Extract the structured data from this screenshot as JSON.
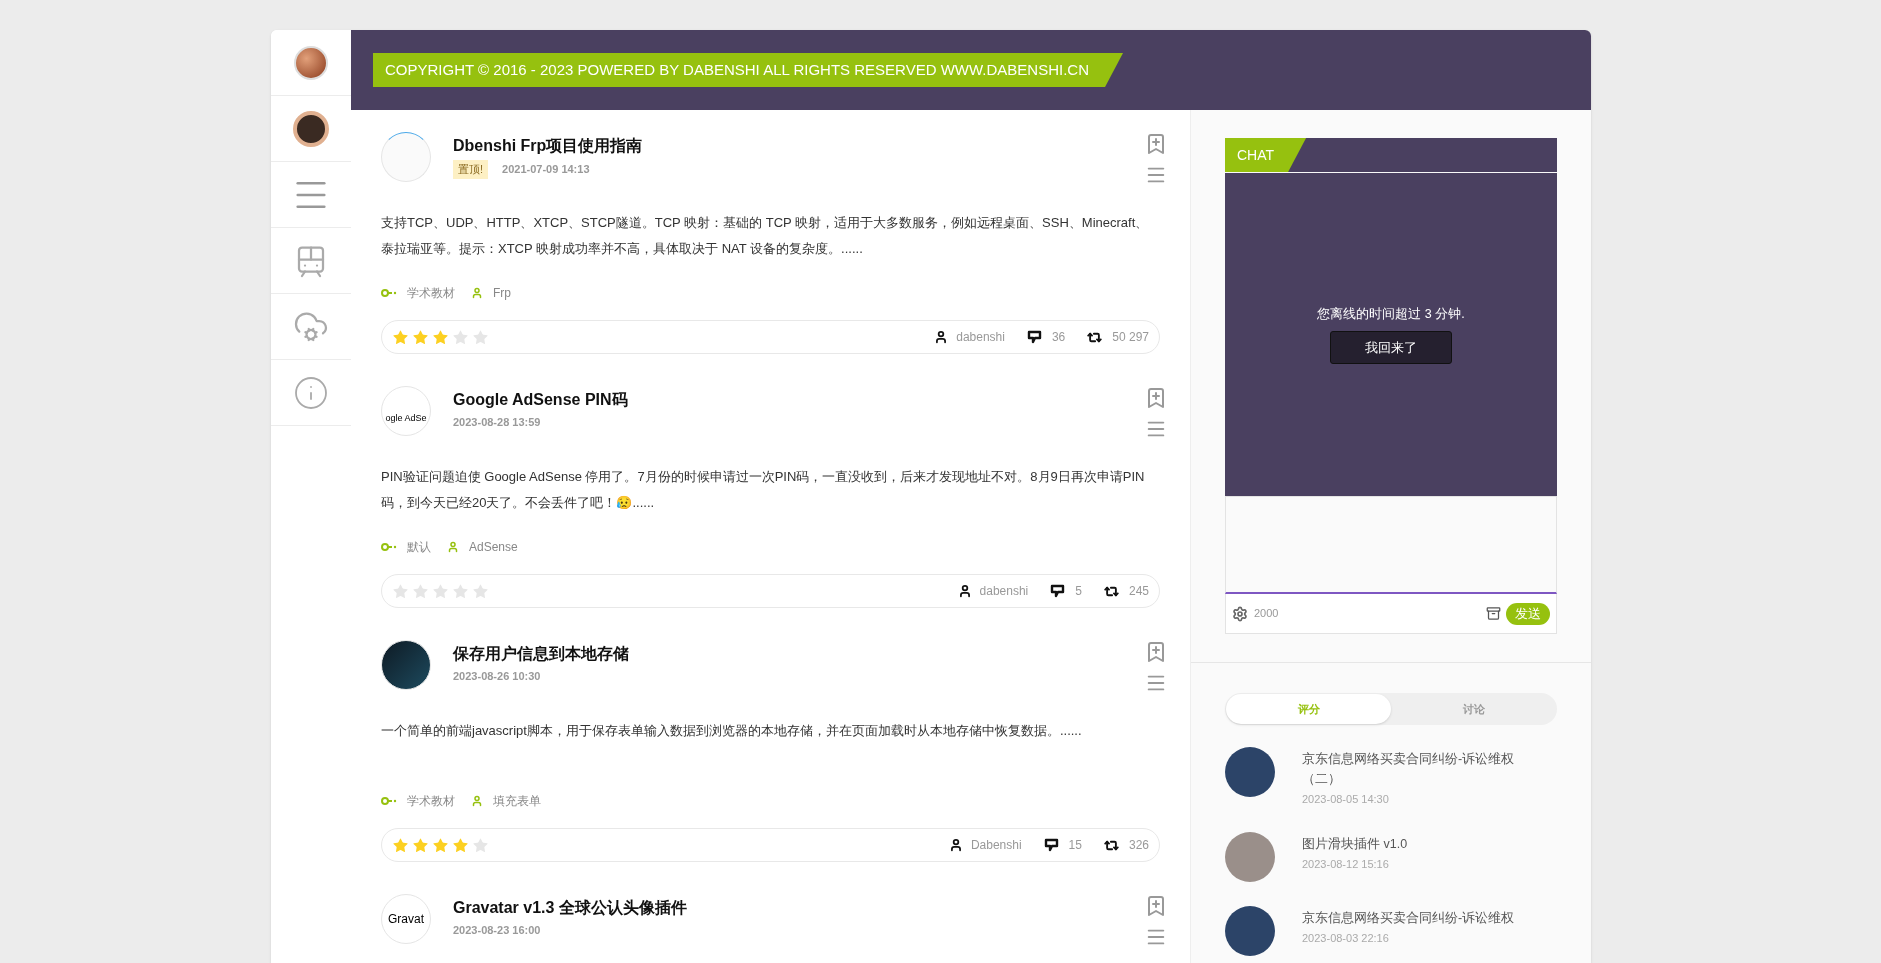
{
  "header": {
    "copyright": "COPYRIGHT © 2016 - 2023 POWERED BY DABENSHI ALL RIGHTS RESERVED WWW.DABENSHI.CN"
  },
  "sidebar": {
    "items": [
      {
        "kind": "logo"
      },
      {
        "kind": "avatar"
      },
      {
        "kind": "menu"
      },
      {
        "kind": "train"
      },
      {
        "kind": "cloud"
      },
      {
        "kind": "info"
      }
    ]
  },
  "posts": [
    {
      "title": "Dbenshi Frp项目使用指南",
      "badge": "置顶!",
      "date": "2021-07-09 14:13",
      "kind": "dots",
      "excerpt": "支持TCP、UDP、HTTP、XTCP、STCP隧道。TCP 映射：基础的 TCP 映射，适用于大多数服务，例如远程桌面、SSH、Minecraft、泰拉瑞亚等。提示：XTCP 映射成功率并不高，具体取决于 NAT 设备的复杂度。......",
      "category": "学术教材",
      "tag": "Frp",
      "stars": 3,
      "author": "dabenshi",
      "comments": "36",
      "views": "50 297"
    },
    {
      "title": "Google AdSense PIN码",
      "date": "2023-08-28 13:59",
      "kind": "adsense",
      "thumb_text": "ogle AdSe",
      "excerpt": "PIN验证问题迫使 Google AdSense 停用了。7月份的时候申请过一次PIN码，一直没收到，后来才发现地址不对。8月9日再次申请PIN码，到今天已经20天了。不会丢件了吧！😥......",
      "category": "默认",
      "tag": "AdSense",
      "stars": 0,
      "author": "dabenshi",
      "comments": "5",
      "views": "245"
    },
    {
      "title": "保存用户信息到本地存储",
      "date": "2023-08-26 10:30",
      "kind": "code",
      "excerpt": "一个简单的前端javascript脚本，用于保存表单输入数据到浏览器的本地存储，并在页面加载时从本地存储中恢复数据。......",
      "category": "学术教材",
      "tag": "填充表单",
      "stars": 4,
      "author": "Dabenshi",
      "comments": "15",
      "views": "326"
    },
    {
      "title": "Gravatar v1.3 全球公认头像插件",
      "date": "2023-08-23 16:00",
      "kind": "gravatar",
      "thumb_text": "Gravat"
    }
  ],
  "chat": {
    "title": "CHAT",
    "message": "您离线的时间超过 3 分钟.",
    "return_button": "我回来了",
    "counter": "2000",
    "send_button": "发送"
  },
  "side_tabs": [
    {
      "label": "评分",
      "selected": true
    },
    {
      "label": "讨论",
      "selected": false
    }
  ],
  "side_list": [
    {
      "title": "京东信息网络买卖合同纠纷-诉讼维权（二）",
      "date": "2023-08-05 14:30",
      "kind": "photo"
    },
    {
      "title": "图片滑块插件 v1.0",
      "date": "2023-08-12 15:16",
      "kind": "person"
    },
    {
      "title": "京东信息网络买卖合同纠纷-诉讼维权",
      "date": "2023-08-03 22:16",
      "kind": "photo"
    }
  ]
}
